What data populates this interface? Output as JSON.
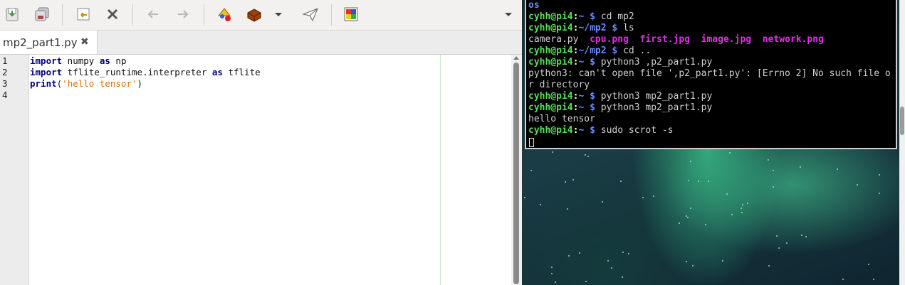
{
  "editor": {
    "toolbar": {
      "icons": [
        "save-icon",
        "save-all-icon",
        "revert-icon",
        "close-file-icon",
        "back-arrow-icon",
        "forward-arrow-icon",
        "run-icon",
        "build-icon",
        "dropdown-icon",
        "send-icon",
        "color-chooser-icon",
        "menu-dropdown-icon"
      ]
    },
    "tab": {
      "label": "mp2_part1.py",
      "close": "✖"
    },
    "lines": {
      "n1": "1",
      "n2": "2",
      "n3": "3",
      "n4": "4",
      "l1_kw1": "import",
      "l1_a": " numpy ",
      "l1_kw2": "as",
      "l1_b": " np",
      "l2_kw1": "import",
      "l2_a": " tflite_runtime.interpreter ",
      "l2_kw2": "as",
      "l2_b": " tflite",
      "l3_kw": "print",
      "l3_a": "(",
      "l3_str": "'hello tensor'",
      "l3_b": ")"
    }
  },
  "terminal": {
    "user": "cyhh@pi4",
    "line0": "os",
    "sep": ":",
    "home": "~",
    "mp2dir": "~/mp2",
    "dollar": " $ ",
    "cmd1": "cd mp2",
    "cmd2": "ls",
    "ls_plain": "camera.py",
    "ls_files": [
      "cpu.png",
      "first.jpg",
      "image.jpg",
      "network.png"
    ],
    "cmd3": "cd ..",
    "cmd4": "python3 ,p2_part1.py",
    "err1": "python3: can't open file ',p2_part1.py': [Errno 2] No such file o",
    "err2": "r directory",
    "cmd5": "python3 mp2_part1.py",
    "cmd6": "python3 mp2_part1.py",
    "out1": "hello tensor",
    "cmd7": "sudo scrot -s"
  }
}
